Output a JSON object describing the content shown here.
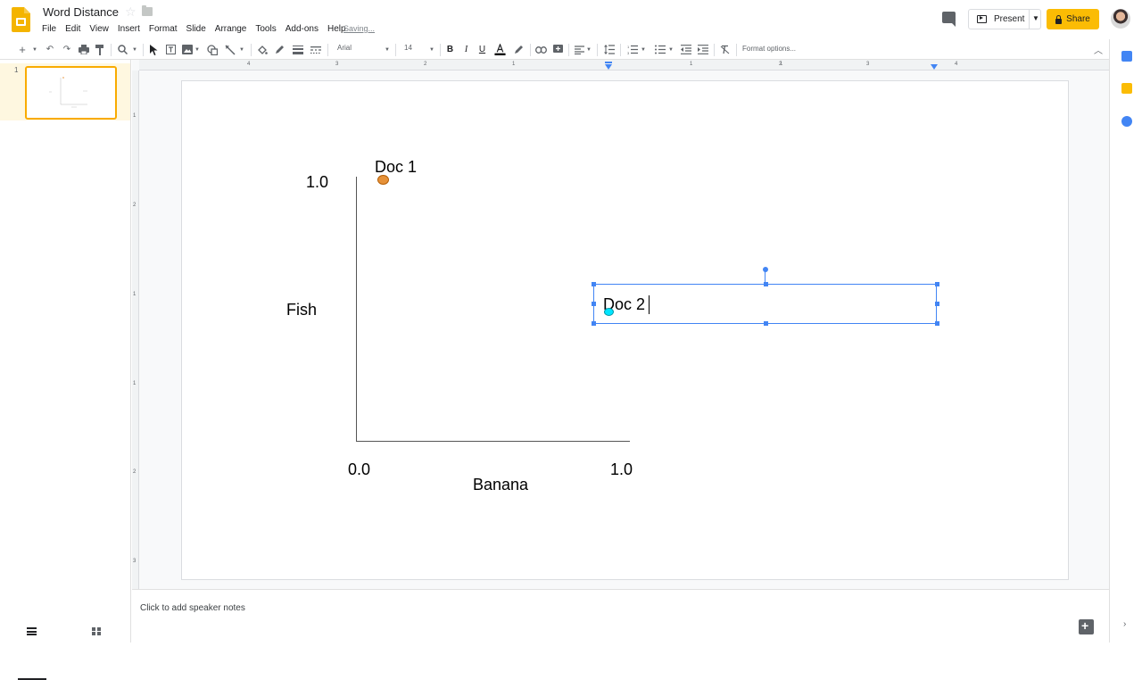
{
  "app": {
    "doc_title": "Word Distance",
    "saving_status": "Saving...",
    "menu": [
      "File",
      "Edit",
      "View",
      "Insert",
      "Format",
      "Slide",
      "Arrange",
      "Tools",
      "Add-ons",
      "Help"
    ],
    "present_label": "Present",
    "share_label": "Share"
  },
  "toolbar": {
    "font_family": "Arial",
    "font_size": "14",
    "format_options": "Format options..."
  },
  "filmstrip": {
    "slide_number": "1"
  },
  "slide": {
    "y_max_label": "1.0",
    "y_axis_label": "Fish",
    "x_min_label": "0.0",
    "x_max_label": "1.0",
    "x_axis_label": "Banana",
    "doc1_label": "Doc 1",
    "doc2_label": "Doc 2",
    "doc1_color": "#e69138",
    "doc2_color": "#00e5ff"
  },
  "ruler": {
    "top_numbers": [
      "4",
      "3",
      "2",
      "1",
      "1",
      "1",
      "2",
      "3",
      "4"
    ],
    "left_numbers": [
      "1",
      "2",
      "1",
      "1",
      "2",
      "3"
    ]
  },
  "notes": {
    "placeholder": "Click to add speaker notes"
  },
  "colors": {
    "accent_yellow": "#fbbc04",
    "selection_blue": "#4285f4"
  }
}
